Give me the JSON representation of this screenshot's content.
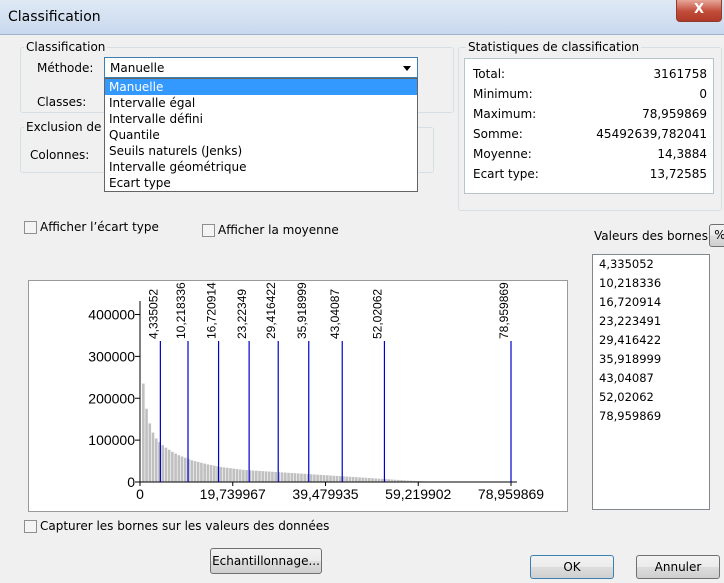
{
  "window": {
    "title": "Classification",
    "close_glyph": "X"
  },
  "classification_group": {
    "label": "Classification",
    "method_label": "Méthode:",
    "method_value": "Manuelle",
    "classes_label": "Classes:"
  },
  "dropdown": {
    "options": [
      "Manuelle",
      "Intervalle égal",
      "Intervalle défini",
      "Quantile",
      "Seuils naturels (Jenks)",
      "Intervalle géométrique",
      "Ecart type"
    ],
    "selected": "Manuelle"
  },
  "exclusion_group": {
    "label": "Exclusion de d",
    "columns_label": "Colonnes:"
  },
  "stats": {
    "label": "Statistiques de classification",
    "rows": [
      {
        "k": "Total:",
        "v": "3161758"
      },
      {
        "k": "Minimum:",
        "v": "0"
      },
      {
        "k": "Maximum:",
        "v": "78,959869"
      },
      {
        "k": "Somme:",
        "v": "45492639,782041"
      },
      {
        "k": "Moyenne:",
        "v": "14,3884"
      },
      {
        "k": "Ecart type:",
        "v": "13,72585"
      }
    ]
  },
  "options": {
    "show_std_label": "Afficher l’écart type",
    "show_mean_label": "Afficher la moyenne",
    "snap_label": "Capturer les bornes sur les valeurs des données"
  },
  "bounds": {
    "label": "Valeurs des bornes",
    "percent_button": "%",
    "values": [
      "4,335052",
      "10,218336",
      "16,720914",
      "23,223491",
      "29,416422",
      "35,918999",
      "43,04087",
      "52,02062",
      "78,959869"
    ]
  },
  "buttons": {
    "sampling": "Echantillonnage...",
    "ok": "OK",
    "cancel": "Annuler"
  },
  "chart_data": {
    "type": "bar",
    "xlim": [
      0,
      78.959869
    ],
    "ylim": [
      0,
      480000
    ],
    "x_ticks": [
      "0",
      "19,739967",
      "39,479935",
      "59,219902",
      "78,959869"
    ],
    "y_ticks": [
      "0",
      "100000",
      "200000",
      "300000",
      "400000"
    ],
    "break_values": [
      4.335052,
      10.218336,
      16.720914,
      23.223491,
      29.416422,
      35.918999,
      43.04087,
      52.02062,
      78.959869
    ],
    "break_labels": [
      "4,335052",
      "10,218336",
      "16,720914",
      "23,22349",
      "29,416422",
      "35,918999",
      "43,04087",
      "52,02062",
      "78,959869"
    ],
    "break_color": "#0000c8",
    "bar_color": "#c0c0c0",
    "histogram": [
      235000,
      175000,
      140000,
      118000,
      104000,
      95000,
      88000,
      82000,
      77000,
      72000,
      68000,
      64000,
      61000,
      58000,
      55000,
      52000,
      50000,
      48000,
      46000,
      44000,
      42000,
      40500,
      39000,
      37500,
      36000,
      35000,
      34000,
      33000,
      32000,
      31000,
      30000,
      29000,
      28500,
      28000,
      27500,
      27000,
      26500,
      26000,
      25500,
      25000,
      24500,
      24000,
      23500,
      23000,
      22500,
      22000,
      21500,
      21000,
      20500,
      20000,
      19500,
      19000,
      18500,
      18000,
      17500,
      17000,
      16500,
      16000,
      15500,
      15000,
      14500,
      14000,
      13500,
      13000,
      12500,
      12000,
      11500,
      11000,
      10500,
      10000,
      9500,
      9000,
      8500,
      8000,
      7500,
      7000,
      6500,
      6000,
      5500,
      5000,
      4500,
      4000,
      3500,
      3000,
      2600,
      2200,
      1900,
      1600,
      1300,
      1100,
      900,
      700,
      550,
      400,
      300,
      200,
      120,
      60,
      30,
      10
    ]
  }
}
